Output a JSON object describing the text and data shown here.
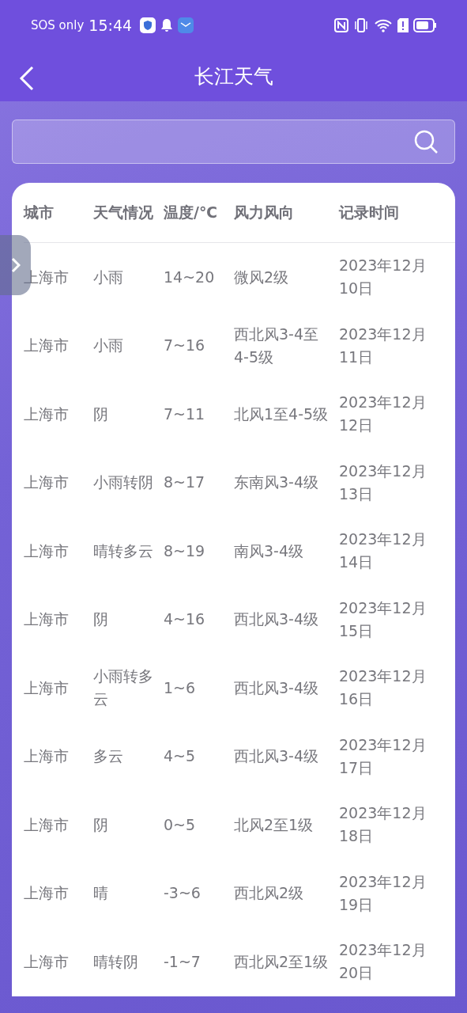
{
  "status_bar": {
    "carrier": "SOS only",
    "time": "15:44"
  },
  "header": {
    "title": "长江天气"
  },
  "table": {
    "columns": [
      "城市",
      "天气情况",
      "温度/℃",
      "风力风向",
      "记录时间"
    ],
    "rows": [
      [
        "上海市",
        "小雨",
        "14~20",
        "微风2级",
        "2023年12月10日"
      ],
      [
        "上海市",
        "小雨",
        "7~16",
        "西北风3-4至4-5级",
        "2023年12月11日"
      ],
      [
        "上海市",
        "阴",
        "7~11",
        "北风1至4-5级",
        "2023年12月12日"
      ],
      [
        "上海市",
        "小雨转阴",
        "8~17",
        "东南风3-4级",
        "2023年12月13日"
      ],
      [
        "上海市",
        "晴转多云",
        "8~19",
        "南风3-4级",
        "2023年12月14日"
      ],
      [
        "上海市",
        "阴",
        "4~16",
        "西北风3-4级",
        "2023年12月15日"
      ],
      [
        "上海市",
        "小雨转多云",
        "1~6",
        "西北风3-4级",
        "2023年12月16日"
      ],
      [
        "上海市",
        "多云",
        "4~5",
        "西北风3-4级",
        "2023年12月17日"
      ],
      [
        "上海市",
        "阴",
        "0~5",
        "北风2至1级",
        "2023年12月18日"
      ],
      [
        "上海市",
        "晴",
        "-3~6",
        "西北风2级",
        "2023年12月19日"
      ],
      [
        "上海市",
        "晴转阴",
        "-1~7",
        "西北风2至1级",
        "2023年12月20日"
      ]
    ]
  }
}
